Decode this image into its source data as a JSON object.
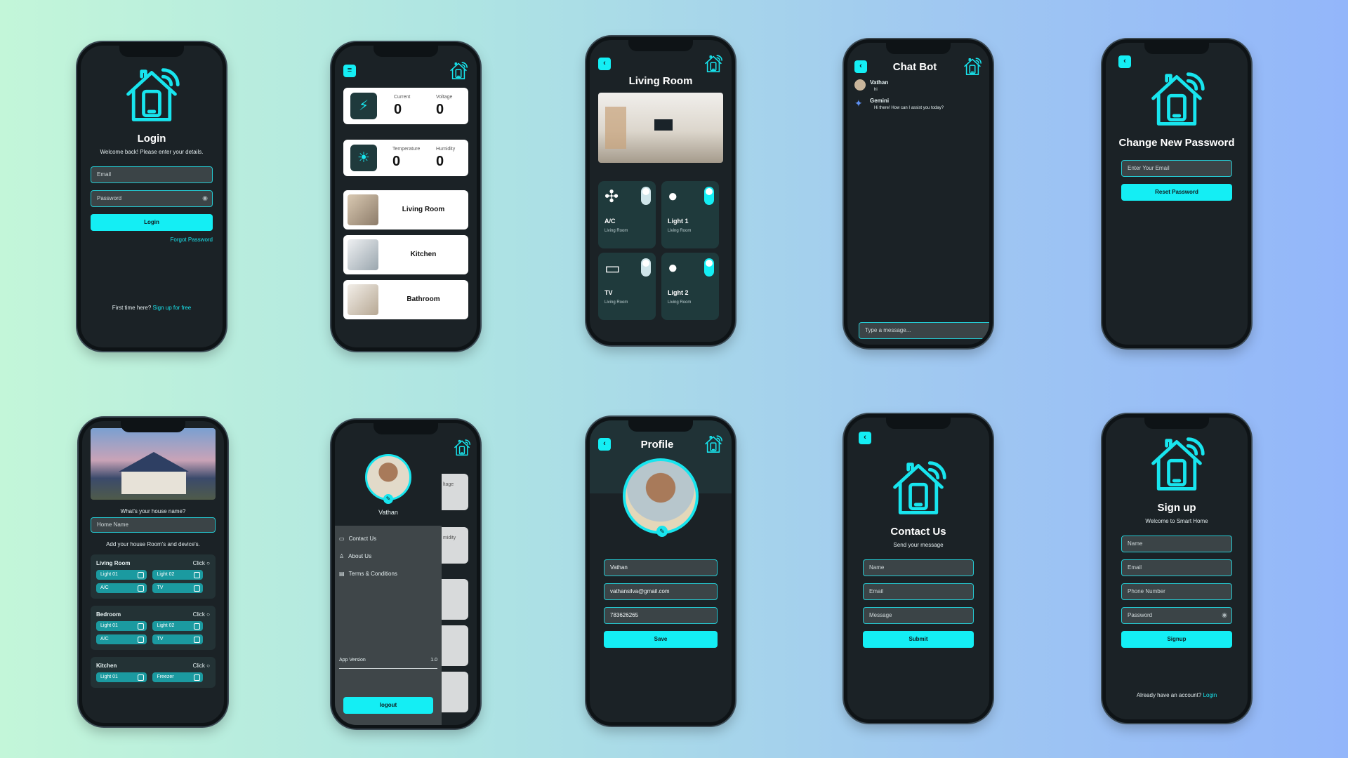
{
  "login": {
    "title": "Login",
    "subtitle": "Welcome back! Please enter your details.",
    "email_placeholder": "Email",
    "password_placeholder": "Password",
    "login_button": "Login",
    "forgot": "Forgot Password",
    "footer_text": "First time here?",
    "footer_link": "Sign up for free"
  },
  "dashboard": {
    "sensor1": {
      "label_a": "Current",
      "value_a": "0",
      "label_b": "Voltage",
      "value_b": "0"
    },
    "sensor2": {
      "label_a": "Temperature",
      "value_a": "0",
      "label_b": "Humidity",
      "value_b": "0"
    },
    "rooms": [
      "Living Room",
      "Kitchen",
      "Bathroom"
    ]
  },
  "living_room": {
    "title": "Living Room",
    "devices": [
      {
        "name": "A/C",
        "room": "Living Room",
        "icon": "fan-icon",
        "on": false
      },
      {
        "name": "Light 1",
        "room": "Living Room",
        "icon": "bulb-icon",
        "on": true
      },
      {
        "name": "TV",
        "room": "Living Room",
        "icon": "tv-icon",
        "on": false
      },
      {
        "name": "Light 2",
        "room": "Living Room",
        "icon": "bulb-icon",
        "on": true
      }
    ]
  },
  "chatbot": {
    "title": "Chat Bot",
    "messages": [
      {
        "sender": "Vathan",
        "text": "hi"
      },
      {
        "sender": "Gemini",
        "text": "Hi there! How can I assist you today?"
      }
    ],
    "input_placeholder": "Type a message..."
  },
  "change_password": {
    "title": "Change New Password",
    "email_placeholder": "Enter Your Email",
    "button": "Reset Password"
  },
  "setup": {
    "question": "What's your house name?",
    "house_placeholder": "Home Name",
    "add_text": "Add your house Room's and device's.",
    "click": "Click",
    "rooms": [
      {
        "name": "Living Room",
        "devices": [
          "Light 01",
          "Light 02",
          "A/C",
          "TV"
        ]
      },
      {
        "name": "Bedroom",
        "devices": [
          "Light 01",
          "Light 02",
          "A/C",
          "TV"
        ]
      },
      {
        "name": "Kitchen",
        "devices": [
          "Light 01",
          "Freezer"
        ]
      }
    ]
  },
  "drawer": {
    "user": "Vathan",
    "items": [
      "Contact Us",
      "About Us",
      "Terms & Conditions"
    ],
    "version_label": "App Version",
    "version": "1.0",
    "logout": "logout",
    "peek_a": "ltage",
    "peek_b": "midity"
  },
  "profile": {
    "title": "Profile",
    "name": "Vathan",
    "email": "vathansilva@gmail.com",
    "phone": "783626265",
    "save": "Save"
  },
  "contact": {
    "title": "Contact Us",
    "subtitle": "Send your message",
    "name_placeholder": "Name",
    "email_placeholder": "Email",
    "message_placeholder": "Message",
    "submit": "Submit"
  },
  "signup": {
    "title": "Sign up",
    "subtitle": "Welcome to Smart Home",
    "name_placeholder": "Name",
    "email_placeholder": "Email",
    "phone_placeholder": "Phone Number",
    "password_placeholder": "Password",
    "button": "Signup",
    "footer_text": "Already have an account?",
    "footer_link": "Login"
  },
  "colors": {
    "accent": "#14eef4",
    "screen": "#1b2226",
    "field": "#3b4447"
  }
}
